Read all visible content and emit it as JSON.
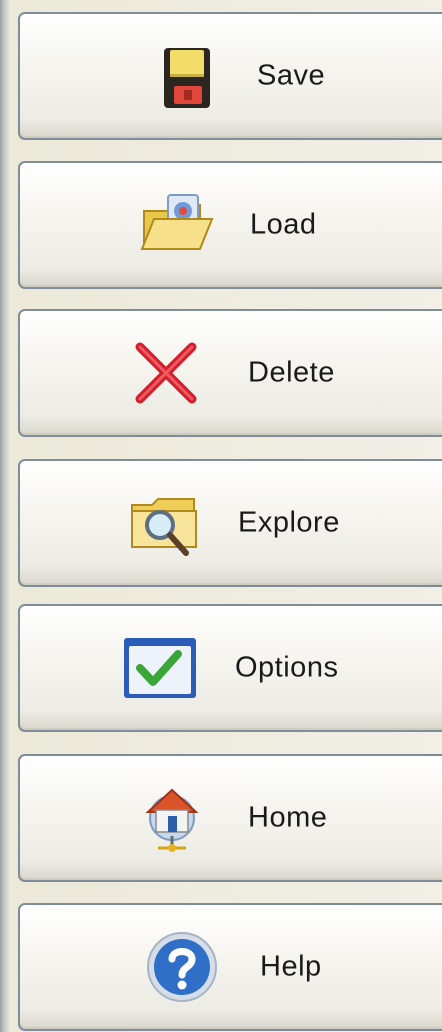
{
  "toolbar": {
    "buttons": [
      {
        "label": "Save",
        "icon": "floppy-disk-icon"
      },
      {
        "label": "Load",
        "icon": "open-folder-icon"
      },
      {
        "label": "Delete",
        "icon": "red-x-icon"
      },
      {
        "label": "Explore",
        "icon": "folder-magnifier-icon"
      },
      {
        "label": "Options",
        "icon": "checkbox-checked-icon"
      },
      {
        "label": "Home",
        "icon": "home-network-icon"
      },
      {
        "label": "Help",
        "icon": "question-mark-icon"
      }
    ]
  },
  "colors": {
    "button_border": "#7f8c99",
    "button_face": "#f6f5f0",
    "delete_red": "#d21f2b",
    "help_blue": "#2f6fc8",
    "check_green": "#3aa63a"
  }
}
